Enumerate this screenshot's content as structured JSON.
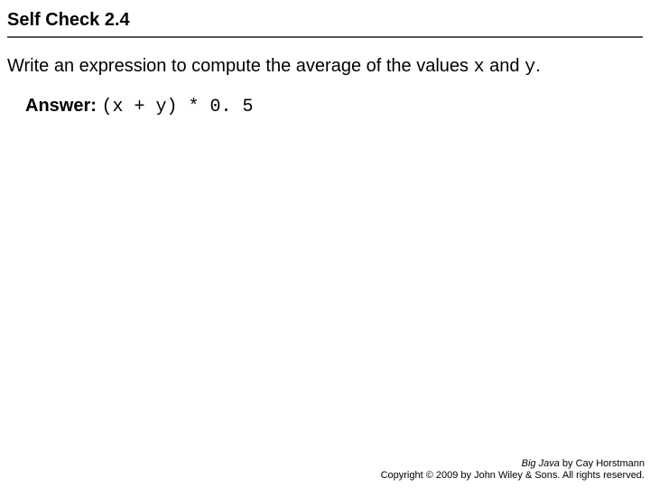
{
  "title": "Self Check 2.4",
  "question": {
    "part1": "Write an expression to compute the average of the values ",
    "var1": "x",
    "part2": " and ",
    "var2": "y",
    "part3": "."
  },
  "answer": {
    "label": "Answer:",
    "code": "(x + y) * 0. 5"
  },
  "footer": {
    "book": "Big Java",
    "author": " by Cay Horstmann",
    "copyright": "Copyright © 2009 by John Wiley & Sons. All rights reserved."
  }
}
